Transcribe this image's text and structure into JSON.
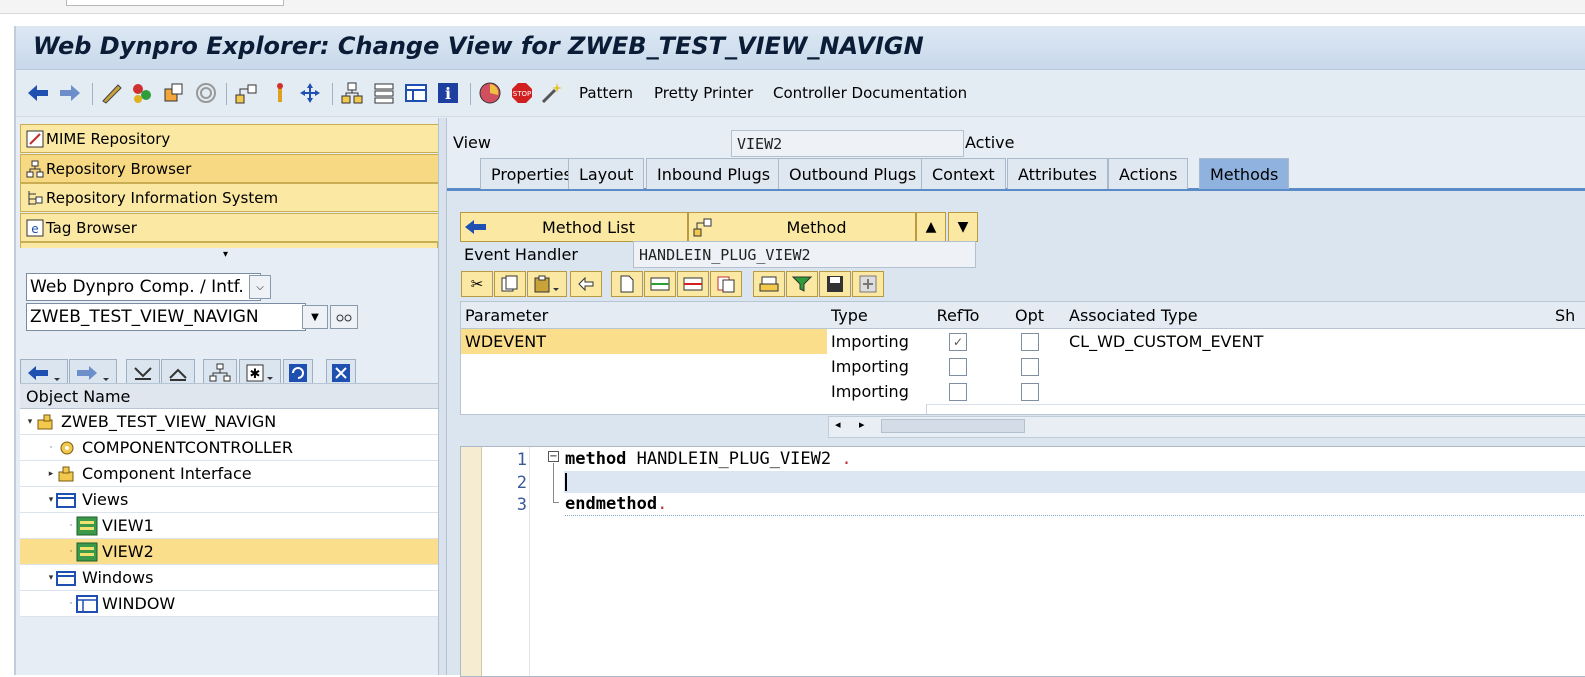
{
  "window": {
    "title": "Web Dynpro Explorer: Change View for ZWEB_TEST_VIEW_NAVIGN"
  },
  "toolbar": {
    "icons": [
      "back-icon",
      "forward-icon",
      "display-change-icon",
      "activate-icon",
      "check-icon",
      "other-object-icon",
      "hierarchy-icon",
      "where-used-icon",
      "navigator-icon",
      "enhance-icon",
      "info-icon",
      "test-icon",
      "breakpoint-icon",
      "wizard-icon"
    ],
    "text_buttons": [
      "Pattern",
      "Pretty Printer",
      "Controller Documentation"
    ]
  },
  "left": {
    "nav_buttons": [
      "MIME Repository",
      "Repository Browser",
      "Repository Information System",
      "Tag Browser"
    ],
    "object_type": "Web Dynpro Comp. / Intf.",
    "object_name": "ZWEB_TEST_VIEW_NAVIGN",
    "tree_header": "Object Name",
    "tree": [
      {
        "label": "ZWEB_TEST_VIEW_NAVIGN"
      },
      {
        "label": "COMPONENTCONTROLLER"
      },
      {
        "label": "Component Interface"
      },
      {
        "label": "Views"
      },
      {
        "label": "VIEW1"
      },
      {
        "label": "VIEW2"
      },
      {
        "label": "Windows"
      },
      {
        "label": "WINDOW"
      }
    ]
  },
  "right": {
    "view_label": "View",
    "view_value": "VIEW2",
    "status": "Active",
    "tabs": [
      "Properties",
      "Layout",
      "Inbound Plugs",
      "Outbound Plugs",
      "Context",
      "Attributes",
      "Actions",
      "Methods"
    ],
    "active_tab": "Methods",
    "method_list_label": "Method List",
    "method_label": "Method",
    "event_handler_label": "Event Handler",
    "event_handler_value": "HANDLEIN_PLUG_VIEW2",
    "grid": {
      "headers": [
        "Parameter",
        "Type",
        "RefTo",
        "Opt",
        "Associated Type",
        "Sh"
      ],
      "rows": [
        {
          "param": "WDEVENT",
          "type": "Importing",
          "refto": true,
          "opt": false,
          "assoc": "CL_WD_CUSTOM_EVENT"
        },
        {
          "param": "",
          "type": "Importing",
          "refto": false,
          "opt": false,
          "assoc": ""
        },
        {
          "param": "",
          "type": "Importing",
          "refto": false,
          "opt": false,
          "assoc": ""
        }
      ]
    },
    "code": {
      "line_numbers": [
        "1",
        "2",
        "3"
      ],
      "line1_kw": "method",
      "line1_rest": " HANDLEIN_PLUG_VIEW2 ",
      "line1_dot": ".",
      "line3_kw": "endmethod",
      "line3_dot": "."
    }
  },
  "colors": {
    "accent": "#5b8bc7",
    "selection": "#fbde8c",
    "button": "#fbe9a3"
  }
}
